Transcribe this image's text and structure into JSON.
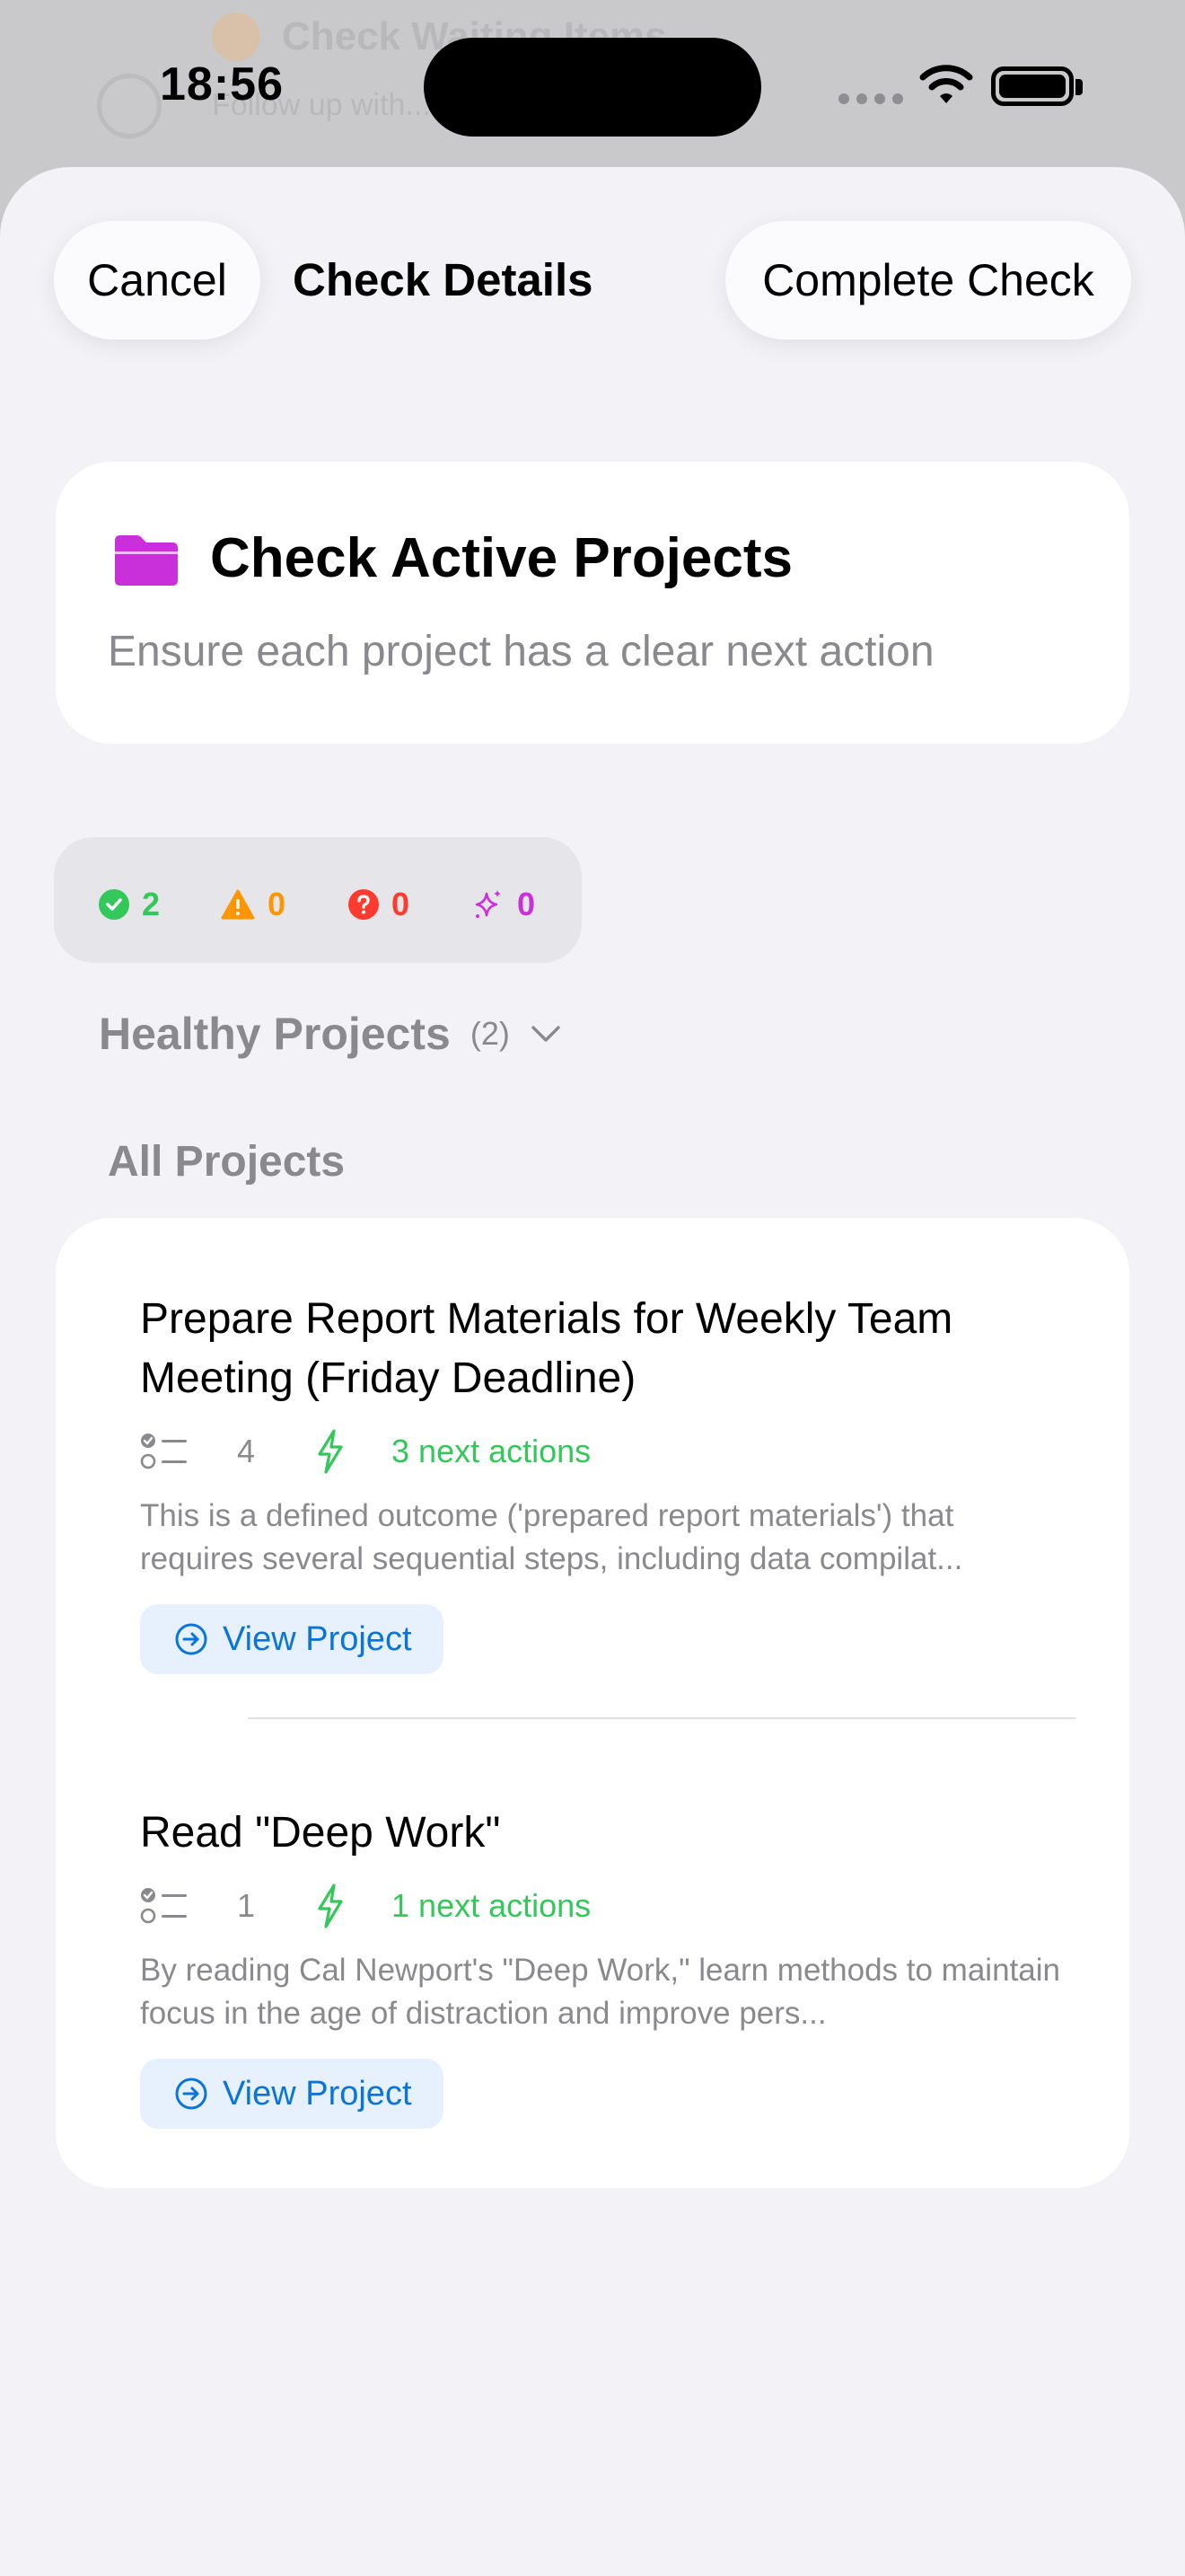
{
  "status_bar": {
    "time": "18:56"
  },
  "background": {
    "title": "Check Waiting Items",
    "subtitle": "Follow up with..."
  },
  "header": {
    "cancel_label": "Cancel",
    "title": "Check Details",
    "complete_label": "Complete Check"
  },
  "check": {
    "title": "Check Active Projects",
    "subtitle": "Ensure each project has a clear next action",
    "icon": "folder-icon",
    "icon_color": "#c930d9"
  },
  "stats": {
    "healthy": "2",
    "warning": "0",
    "question": "0",
    "sparkle": "0",
    "colors": {
      "healthy": "#34c759",
      "warning": "#ff9500",
      "question": "#ff3b30",
      "sparkle": "#c930d9"
    }
  },
  "healthy_section": {
    "title": "Healthy Projects",
    "count": "(2)"
  },
  "all_projects": {
    "label": "All Projects",
    "items": [
      {
        "title": "Prepare Report Materials for Weekly Team Meeting (Friday Deadline)",
        "task_count": "4",
        "next_actions": "3 next actions",
        "description": "This is a defined outcome ('prepared report materials') that requires several sequential steps, including data compilat...",
        "view_label": "View Project"
      },
      {
        "title": "Read \"Deep Work\"",
        "task_count": "1",
        "next_actions": "1 next actions",
        "description": "By reading Cal Newport's \"Deep Work,\" learn methods to maintain focus in the age of distraction and improve pers...",
        "view_label": "View Project"
      }
    ]
  },
  "colors": {
    "accent": "#0a74da",
    "success": "#34c759"
  }
}
